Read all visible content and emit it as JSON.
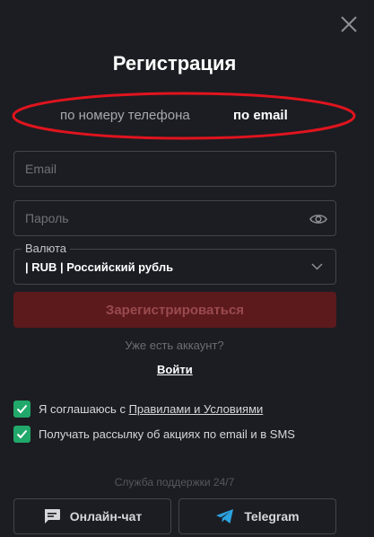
{
  "modal": {
    "title": "Регистрация",
    "tabs": [
      {
        "label": "по номеру телефона",
        "active": false
      },
      {
        "label": "по email",
        "active": true
      }
    ],
    "email": {
      "placeholder": "Email",
      "value": ""
    },
    "password": {
      "placeholder": "Пароль",
      "value": ""
    },
    "currency": {
      "legend": "Валюта",
      "selected": "| RUB | Российский рубль"
    },
    "submit_label": "Зарегистрироваться",
    "have_account": "Уже есть аккаунт?",
    "login_label": "Войти",
    "consents": {
      "terms_prefix": "Я соглашаюсь с ",
      "terms_link": "Правилами и Условиями",
      "terms_checked": true,
      "newsletter": "Получать рассылку об акциях по email и в SMS",
      "newsletter_checked": true
    },
    "support": {
      "title": "Служба поддержки 24/7",
      "chat_label": "Онлайн-чат",
      "telegram_label": "Telegram"
    }
  },
  "colors": {
    "background": "#1c1d22",
    "submit_bg": "#5c1a1d",
    "checkbox": "#21a86b",
    "annotation": "#e0141e",
    "telegram": "#2aa3e0"
  }
}
